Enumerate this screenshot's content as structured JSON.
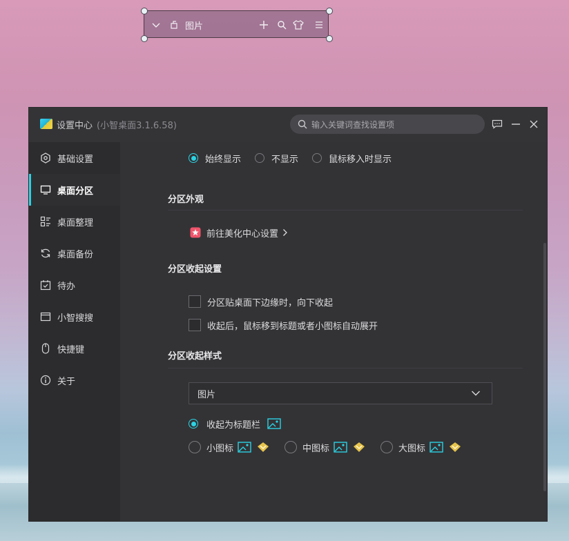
{
  "fence": {
    "label": "图片",
    "icons": [
      "chevron-down-icon",
      "partition-icon",
      "plus-icon",
      "search-icon",
      "shirt-icon",
      "menu-icon"
    ]
  },
  "window": {
    "title": "设置中心",
    "version": "(小智桌面3.1.6.58)",
    "search_placeholder": "输入关键词查找设置项"
  },
  "sidebar": {
    "items": [
      {
        "label": "基础设置",
        "icon": "gear-icon"
      },
      {
        "label": "桌面分区",
        "icon": "monitor-icon",
        "active": true
      },
      {
        "label": "桌面整理",
        "icon": "grid-list-icon"
      },
      {
        "label": "桌面备份",
        "icon": "sync-icon"
      },
      {
        "label": "待办",
        "icon": "calendar-check-icon"
      },
      {
        "label": "小智搜搜",
        "icon": "window-icon"
      },
      {
        "label": "快捷键",
        "icon": "mouse-icon"
      },
      {
        "label": "关于",
        "icon": "info-icon"
      }
    ]
  },
  "content": {
    "display_options": [
      {
        "label": "始终显示",
        "selected": true
      },
      {
        "label": "不显示",
        "selected": false
      },
      {
        "label": "鼠标移入时显示",
        "selected": false
      }
    ],
    "appearance": {
      "heading": "分区外观",
      "link_label": "前往美化中心设置"
    },
    "collapse_settings": {
      "heading": "分区收起设置",
      "options": [
        {
          "label": "分区贴桌面下边缘时，向下收起",
          "checked": false
        },
        {
          "label": "收起后，鼠标移到标题或者小图标自动展开",
          "checked": false
        }
      ]
    },
    "collapse_style": {
      "heading": "分区收起样式",
      "select_value": "图片",
      "option_title": "收起为标题栏",
      "option_small": "小图标",
      "option_medium": "中图标",
      "option_large": "大图标"
    }
  },
  "colors": {
    "accent": "#2bd3e3",
    "window_bg": "#333336",
    "sidebar_bg": "#2c2c2e",
    "premium_gold": "#e6c34a"
  }
}
